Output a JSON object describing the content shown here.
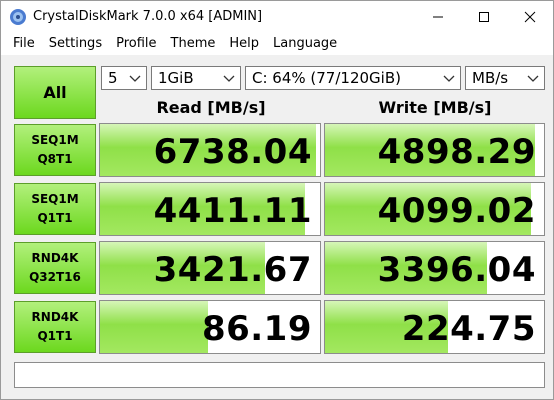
{
  "window": {
    "title": "CrystalDiskMark 7.0.0 x64 [ADMIN]"
  },
  "menu": [
    "File",
    "Settings",
    "Profile",
    "Theme",
    "Help",
    "Language"
  ],
  "controls": {
    "all_label": "All",
    "count": "5",
    "size": "1GiB",
    "drive": "C: 64% (77/120GiB)",
    "unit": "MB/s"
  },
  "headers": {
    "read": "Read [MB/s]",
    "write": "Write [MB/s]"
  },
  "tests": [
    {
      "line1": "SEQ1M",
      "line2": "Q8T1",
      "read": "6738.04",
      "write": "4898.29",
      "read_level": 0.98,
      "write_level": 0.96
    },
    {
      "line1": "SEQ1M",
      "line2": "Q1T1",
      "read": "4411.11",
      "write": "4099.02",
      "read_level": 0.93,
      "write_level": 0.94
    },
    {
      "line1": "RND4K",
      "line2": "Q32T16",
      "read": "3421.67",
      "write": "3396.04",
      "read_level": 0.75,
      "write_level": 0.74
    },
    {
      "line1": "RND4K",
      "line2": "Q1T1",
      "read": "86.19",
      "write": "224.75",
      "read_level": 0.49,
      "write_level": 0.56
    }
  ],
  "comment": "",
  "colors": {
    "accent": "#6cd81e",
    "bar_fill": "#8fe048"
  }
}
